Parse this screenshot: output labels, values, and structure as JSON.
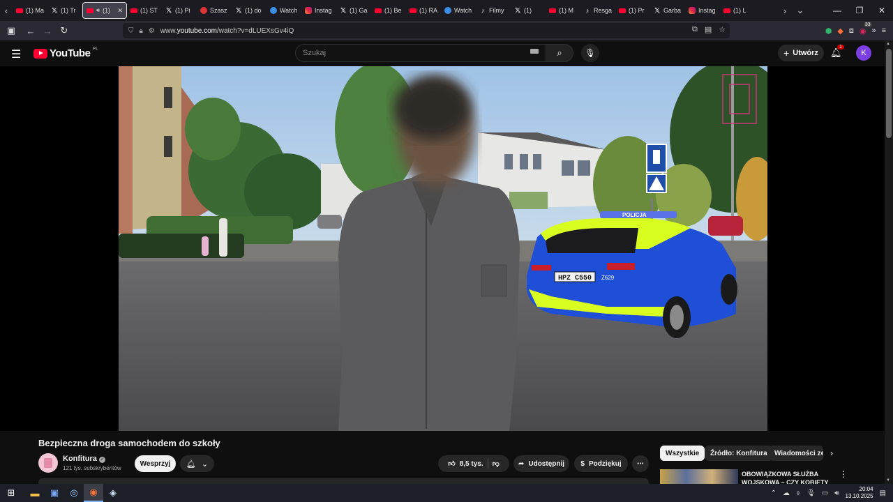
{
  "browser": {
    "tabs": [
      {
        "icon": "youtube-icon",
        "label": "(1) Ma"
      },
      {
        "icon": "x-icon",
        "label": "(1) Tr"
      },
      {
        "icon": "youtube-icon",
        "label": "(1)",
        "active": true
      },
      {
        "icon": "youtube-icon",
        "label": "(1) ST"
      },
      {
        "icon": "x-icon",
        "label": "(1) Pi"
      },
      {
        "icon": "flag-icon",
        "label": "Szasz"
      },
      {
        "icon": "x-icon",
        "label": "(1) do"
      },
      {
        "icon": "watch-icon",
        "label": "Watch"
      },
      {
        "icon": "instagram-icon",
        "label": "Instag"
      },
      {
        "icon": "x-icon",
        "label": "(1) Ga"
      },
      {
        "icon": "youtube-icon",
        "label": "(1) Be"
      },
      {
        "icon": "youtube-icon",
        "label": "(1) RA"
      },
      {
        "icon": "watch-icon",
        "label": "Watch"
      },
      {
        "icon": "tiktok-icon",
        "label": "Filmy"
      },
      {
        "icon": "x-icon",
        "label": "(1)"
      },
      {
        "icon": "youtube-icon",
        "label": "(1) M"
      },
      {
        "icon": "tiktok-icon",
        "label": "Resga"
      },
      {
        "icon": "youtube-icon",
        "label": "(1) Pr"
      },
      {
        "icon": "x-icon",
        "label": "Garba"
      },
      {
        "icon": "instagram-icon",
        "label": "Instag"
      },
      {
        "icon": "youtube-icon",
        "label": "(1) L"
      }
    ],
    "url_prefix": "www.",
    "url_domain": "youtube.com",
    "url_path": "/watch?v=dLUEXsGv4iQ",
    "extension_badge": "33"
  },
  "youtube": {
    "logo_text": "YouTube",
    "country_code": "PL",
    "search_placeholder": "Szukaj",
    "create_label": "Utwórz",
    "notifications_count": "1",
    "avatar_letter": "K"
  },
  "video": {
    "title": "Bezpieczna droga samochodem do szkoły",
    "plate_text": "HPZ C550",
    "police_text": "POLICJA",
    "car_number": "Z629"
  },
  "channel": {
    "name": "Konfitura",
    "subscribers": "121 tys. subskrybentów",
    "support_label": "Wesprzyj"
  },
  "actions": {
    "likes": "8,5 tys.",
    "share_label": "Udostępnij",
    "thanks_label": "Podziękuj"
  },
  "chips": [
    "Wszystkie",
    "Źródło: Konfitura",
    "Wiadomości ze ś"
  ],
  "recommendation": {
    "title": "OBOWIĄZKOWA SŁUŻBA WOJSKOWA – CZY KOBIETY"
  },
  "taskbar": {
    "time": "20:04",
    "date": "13.10.2025"
  },
  "colors": {
    "accent_red": "#ff0033",
    "avatar_purple": "#7b3fe4",
    "police_blue": "#1e4fd6",
    "police_yellow": "#d8ff1f"
  }
}
